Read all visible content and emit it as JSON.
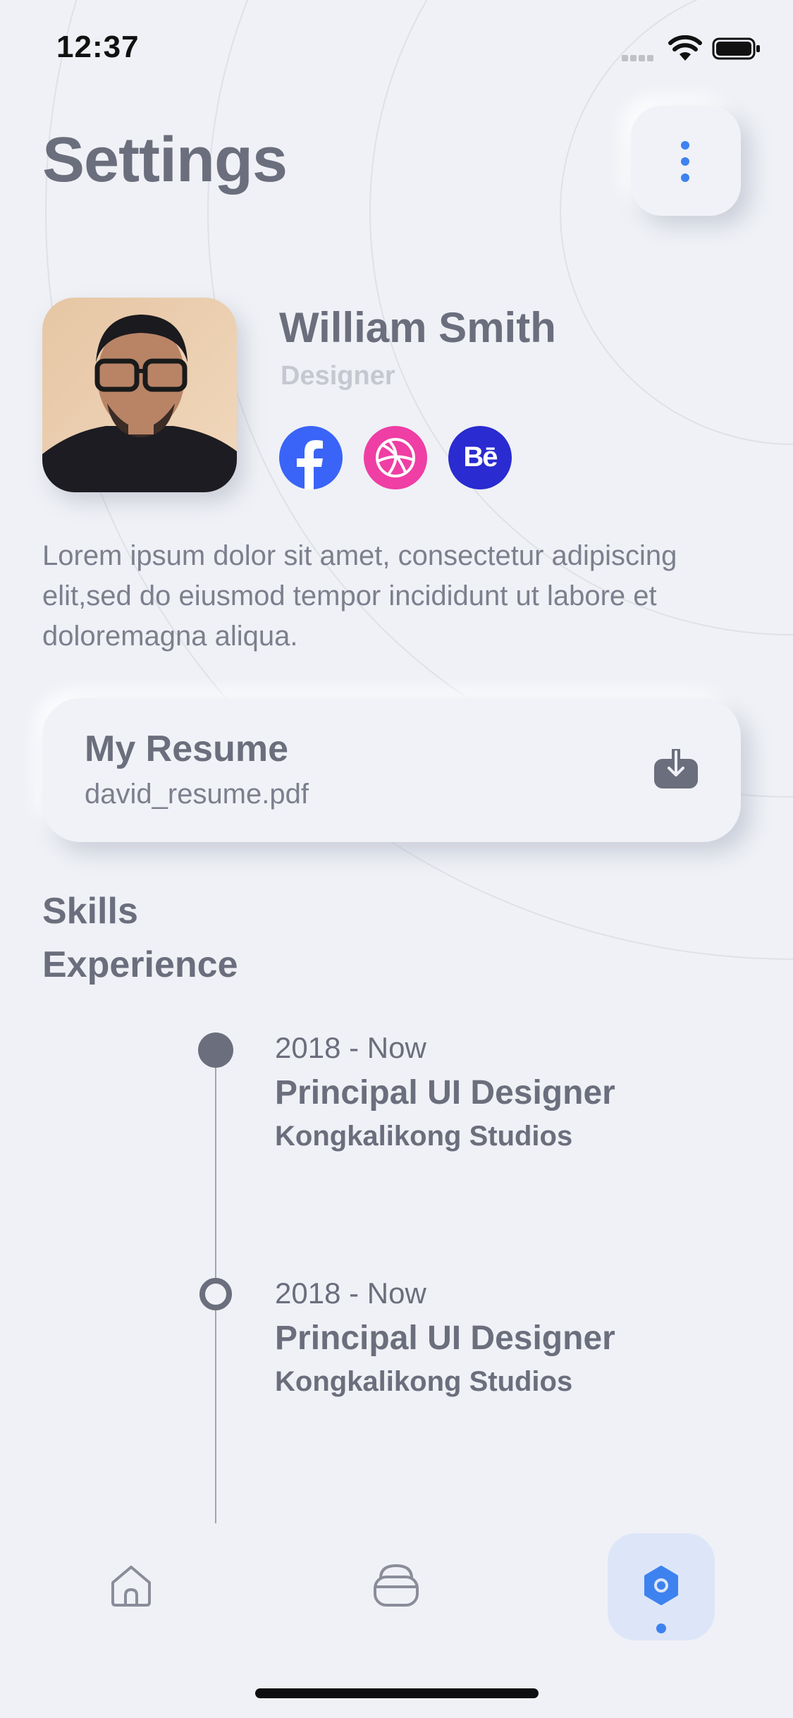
{
  "status_bar": {
    "time": "12:37"
  },
  "header": {
    "title": "Settings",
    "menu_icon": "more-vertical-icon"
  },
  "profile": {
    "name": "William Smith",
    "role": "Designer",
    "socials": [
      {
        "name": "facebook-icon",
        "color": "#3a64f7"
      },
      {
        "name": "dribbble-icon",
        "color": "#ef3ea4"
      },
      {
        "name": "behance-icon",
        "color": "#2a2bd0",
        "label": "Bē"
      }
    ]
  },
  "bio": "Lorem ipsum dolor sit amet, consectetur adipiscing elit,sed do eiusmod tempor incididunt ut labore et doloremagna aliqua.",
  "resume": {
    "title": "My Resume",
    "file": "david_resume.pdf",
    "icon": "download-icon"
  },
  "sections": {
    "skills": "Skills",
    "experience": "Experience"
  },
  "experience": [
    {
      "period": "2018 - Now",
      "title": "Principal UI Designer",
      "company": "Kongkalikong Studios"
    },
    {
      "period": "2018 - Now",
      "title": "Principal UI Designer",
      "company": "Kongkalikong Studios"
    }
  ],
  "nav": {
    "items": [
      "home-icon",
      "bag-icon",
      "settings-icon"
    ],
    "active": "settings-icon",
    "accent": "#3e82f0"
  }
}
